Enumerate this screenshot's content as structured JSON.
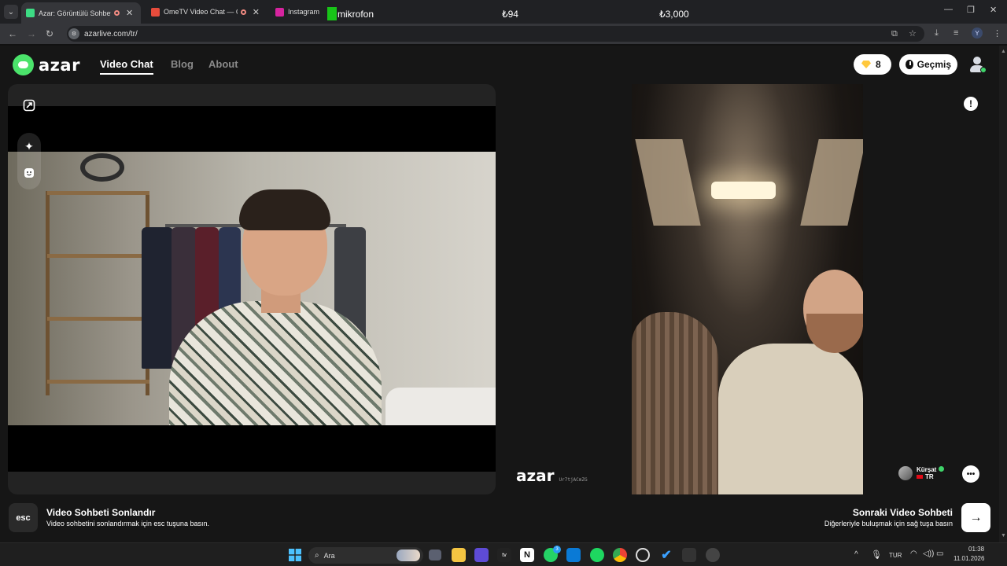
{
  "browser": {
    "tabs": [
      {
        "title": "Azar: Görüntülü Sohbet & V",
        "active": true,
        "recording": true,
        "favicon_color": "#3ddc84"
      },
      {
        "title": "OmeTV Video Chat — Ome",
        "active": false,
        "recording": true,
        "favicon_color": "#e74c3c"
      },
      {
        "title": "Instagram",
        "active": false,
        "recording": false,
        "favicon_color": "#d6249f"
      }
    ],
    "overlay": {
      "mic_label": "mikrofon",
      "value_1": "₺94",
      "value_2": "₺3,000"
    },
    "url": "azarlive.com/tr/",
    "profile_initial": "Y"
  },
  "azar": {
    "logo_text": "azar",
    "nav": [
      {
        "label": "Video Chat",
        "active": true
      },
      {
        "label": "Blog",
        "active": false
      },
      {
        "label": "About",
        "active": false
      }
    ],
    "gems_count": "8",
    "history_label": "Geçmiş",
    "watermark": "azar",
    "session_code": "Ur7tjACmZG",
    "peer": {
      "name": "Kürşat",
      "country": "TR"
    },
    "end_chat": {
      "key": "esc",
      "title": "Video Sohbeti Sonlandır",
      "subtitle": "Video sohbetini sonlandırmak için esc tuşuna basın."
    },
    "next_chat": {
      "title": "Sonraki Video Sohbeti",
      "subtitle": "Diğerleriyle buluşmak için sağ tuşa basın",
      "key_icon": "→"
    }
  },
  "icons": {
    "expand": "expand-icon",
    "effects": "sparkle-icon",
    "filters": "face-icon",
    "report": "report-icon",
    "chat": "chat-bubble-icon"
  },
  "taskbar": {
    "search_placeholder": "Ara",
    "language": "TUR",
    "time": "01:38",
    "date": "11.01.2026",
    "whatsapp_badge": "3"
  },
  "colors": {
    "brand": "#4be36b",
    "gem": "#ffc83d",
    "background": "#161616"
  }
}
